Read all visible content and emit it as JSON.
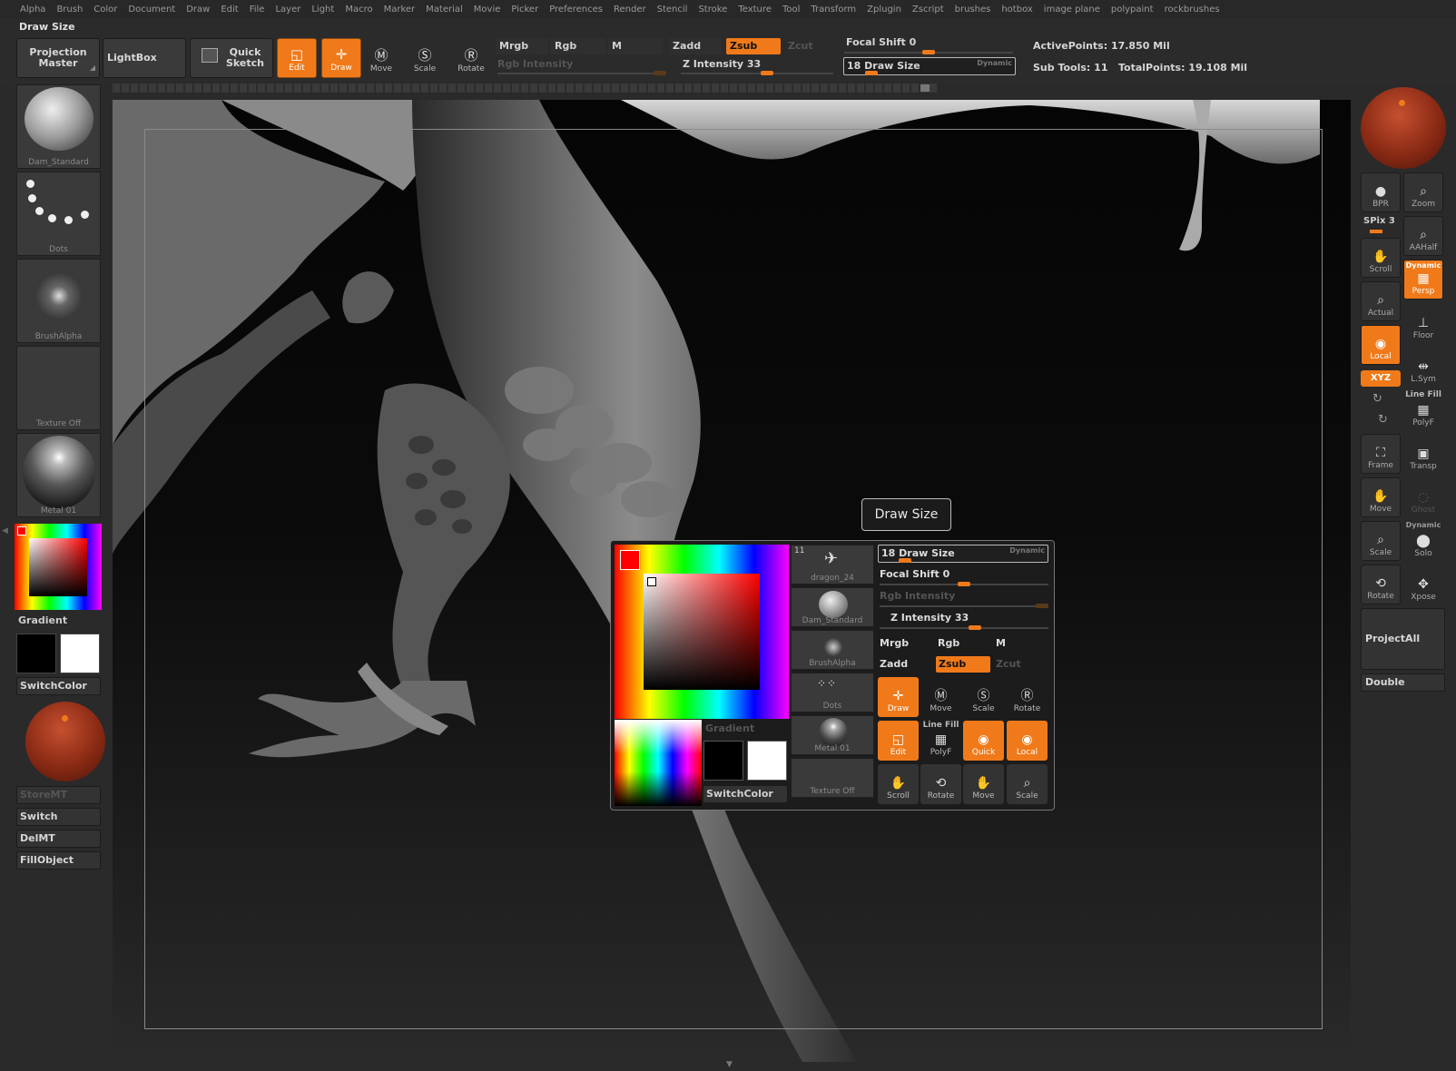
{
  "menu": [
    "Alpha",
    "Brush",
    "Color",
    "Document",
    "Draw",
    "Edit",
    "File",
    "Layer",
    "Light",
    "Macro",
    "Marker",
    "Material",
    "Movie",
    "Picker",
    "Preferences",
    "Render",
    "Stencil",
    "Stroke",
    "Texture",
    "Tool",
    "Transform",
    "Zplugin",
    "Zscript",
    "brushes",
    "hotbox",
    "image plane",
    "polypaint",
    "rockbrushes"
  ],
  "title": "Draw Size",
  "toolbar": {
    "projection_master": "Projection Master",
    "lightbox": "LightBox",
    "quick_sketch": "Quick Sketch",
    "edit": "Edit",
    "draw": "Draw",
    "move": "Move",
    "scale": "Scale",
    "rotate": "Rotate",
    "mrgb": "Mrgb",
    "rgb": "Rgb",
    "m": "M",
    "zadd": "Zadd",
    "zsub": "Zsub",
    "zcut": "Zcut",
    "rgb_intensity": "Rgb Intensity",
    "z_intensity": "Z Intensity 33",
    "z_intensity_value": 33,
    "focal_shift": "Focal Shift 0",
    "draw_size": "18 Draw Size",
    "draw_size_value": 18,
    "dynamic": "Dynamic",
    "active_points": "ActivePoints: 17.850 Mil",
    "sub_tools": "Sub Tools: 11",
    "total_points": "TotalPoints: 19.108 Mil"
  },
  "left_shelf": {
    "brush": "Dam_Standard",
    "stroke": "Dots",
    "alpha": "BrushAlpha",
    "texture": "Texture Off",
    "material": "Metal 01",
    "gradient": "Gradient",
    "switch_color": "SwitchColor",
    "store_mt": "StoreMT",
    "switch": "Switch",
    "del_mt": "DelMT",
    "fill_object": "FillObject"
  },
  "right_shelf": {
    "bpr": "BPR",
    "zoom": "Zoom",
    "spix": "SPix 3",
    "aahalf": "AAHalf",
    "scroll": "Scroll",
    "dynamic": "Dynamic",
    "persp": "Persp",
    "actual": "Actual",
    "floor": "Floor",
    "local": "Local",
    "xyz": "XYZ",
    "lsym": "L.Sym",
    "line_fill": "Line Fill",
    "polyf": "PolyF",
    "frame": "Frame",
    "transp": "Transp",
    "move": "Move",
    "ghost": "Ghost",
    "scale": "Scale",
    "solo": "Solo",
    "rotate": "Rotate",
    "xpose": "Xpose",
    "project_all": "ProjectAll",
    "double": "Double"
  },
  "tooltip": "Draw Size",
  "popup": {
    "tool_count": "11",
    "tool": "dragon_24",
    "brush": "Dam_Standard",
    "alpha": "BrushAlpha",
    "stroke": "Dots",
    "material": "Metal 01",
    "texture": "Texture Off",
    "gradient": "Gradient",
    "switch_color": "SwitchColor",
    "draw_size": "18 Draw Size",
    "dynamic": "Dynamic",
    "focal_shift": "Focal Shift 0",
    "rgb_intensity": "Rgb Intensity",
    "z_intensity": "Z Intensity 33",
    "mrgb": "Mrgb",
    "rgb": "Rgb",
    "m": "M",
    "zadd": "Zadd",
    "zsub": "Zsub",
    "zcut": "Zcut",
    "draw": "Draw",
    "move": "Move",
    "scale": "Scale",
    "rotate": "Rotate",
    "edit": "Edit",
    "line_fill": "Line Fill",
    "polyf": "PolyF",
    "quick": "Quick",
    "local": "Local",
    "scroll": "Scroll",
    "rotate2": "Rotate",
    "move2": "Move",
    "scale2": "Scale"
  },
  "colors": {
    "accent": "#f07a1a",
    "selected_color": "#ff0000"
  }
}
